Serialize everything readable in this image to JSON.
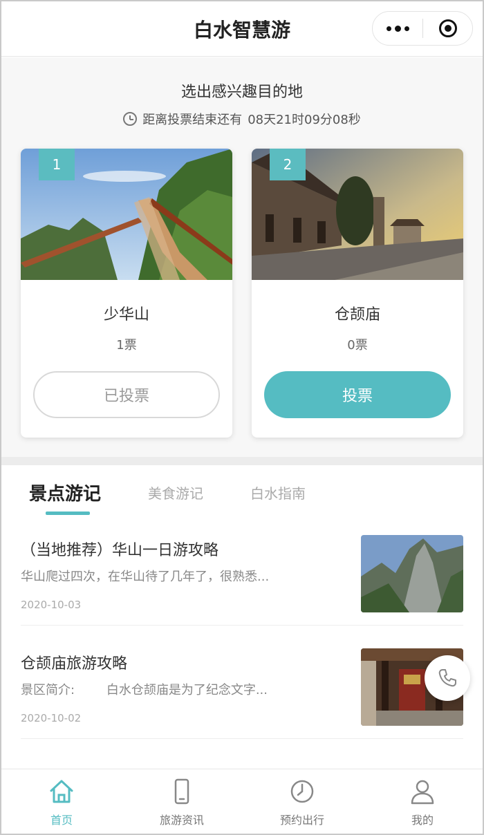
{
  "header": {
    "title": "白水智慧游"
  },
  "vote": {
    "heading": "选出感兴趣目的地",
    "countdown_label": "距离投票结束还有",
    "countdown_value": "08天21时09分08秒",
    "options": [
      {
        "rank": "1",
        "name": "少华山",
        "votes": "1票",
        "button": "已投票",
        "voted": true
      },
      {
        "rank": "2",
        "name": "仓颉庙",
        "votes": "0票",
        "button": "投票",
        "voted": false
      }
    ]
  },
  "tabs": [
    {
      "label": "景点游记",
      "active": true
    },
    {
      "label": "美食游记",
      "active": false
    },
    {
      "label": "白水指南",
      "active": false
    }
  ],
  "articles": [
    {
      "title": "（当地推荐）华山一日游攻略",
      "summary": "华山爬过四次，在华山待了几年了，很熟悉...",
      "date": "2020-10-03"
    },
    {
      "title": "仓颉庙旅游攻略",
      "summary": "景区简介:        白水仓颉庙是为了纪念文字...",
      "date": "2020-10-02"
    }
  ],
  "bottom_nav": [
    {
      "label": "首页",
      "icon": "home-icon",
      "active": true
    },
    {
      "label": "旅游资讯",
      "icon": "phone-icon",
      "active": false
    },
    {
      "label": "预约出行",
      "icon": "clock-icon",
      "active": false
    },
    {
      "label": "我的",
      "icon": "user-icon",
      "active": false
    }
  ],
  "colors": {
    "accent": "#55bcc2"
  }
}
